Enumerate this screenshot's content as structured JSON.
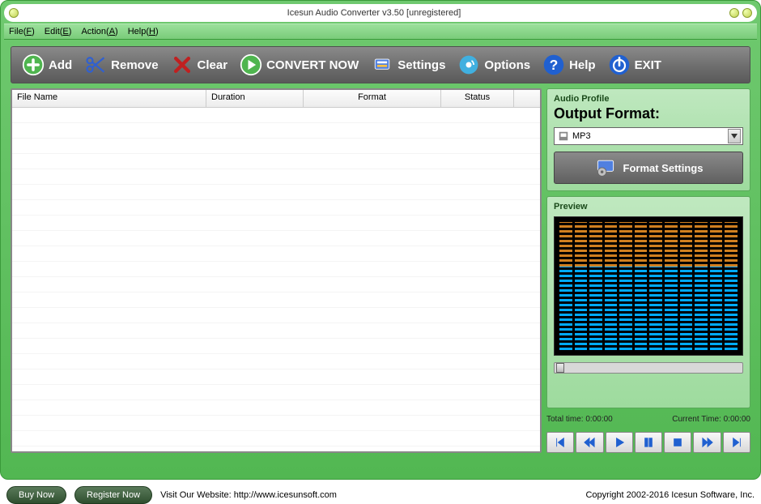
{
  "window": {
    "title": "Icesun Audio Converter v3.50 [unregistered]"
  },
  "menubar": {
    "file": "File(F)",
    "edit": "Edit(E)",
    "action": "Action(A)",
    "help": "Help(H)"
  },
  "toolbar": {
    "add": "Add",
    "remove": "Remove",
    "clear": "Clear",
    "convert": "CONVERT NOW",
    "settings": "Settings",
    "options": "Options",
    "help": "Help",
    "exit": "EXIT"
  },
  "file_table": {
    "headers": {
      "filename": "File Name",
      "duration": "Duration",
      "format": "Format",
      "status": "Status"
    },
    "rows": []
  },
  "audio_profile": {
    "group_title": "Audio Profile",
    "label": "Output Format:",
    "selected": "MP3",
    "format_settings": "Format Settings"
  },
  "preview": {
    "group_title": "Preview",
    "total_time_label": "Total time:",
    "total_time_value": "0:00:00",
    "current_time_label": "Current Time:",
    "current_time_value": "0:00:00"
  },
  "footer": {
    "buy_now": "Buy Now",
    "register_now": "Register Now",
    "website_text": "Visit Our Website: http://www.icesunsoft.com",
    "copyright": "Copyright 2002-2016 Icesun Software, Inc."
  }
}
